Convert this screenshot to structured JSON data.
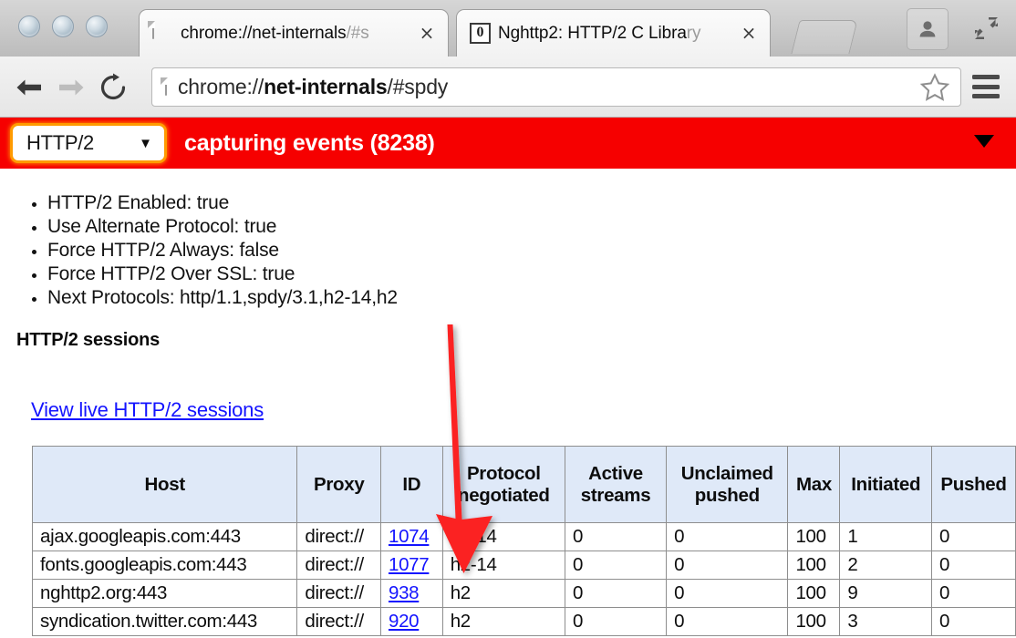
{
  "window": {
    "traffic_lights": [
      "close",
      "minimize",
      "zoom"
    ]
  },
  "tabs": [
    {
      "favicon": "page-icon",
      "title_main": "chrome://net-internals",
      "title_sub": "/#s",
      "close_label": "×",
      "active": true
    },
    {
      "favicon": "nghttp2-icon",
      "favicon_text": "0",
      "title_main": "Nghttp2: HTTP/2 C Libra",
      "title_sub": "ry",
      "close_label": "×",
      "active": false
    }
  ],
  "tabstrip": {
    "new_tab_label": "New Tab",
    "profile_label": "Profile",
    "fullscreen_label": "Enter Full Screen"
  },
  "toolbar": {
    "back_label": "←",
    "forward_label": "→",
    "reload_label": "⟳",
    "url_scheme": "chrome://",
    "url_host": "net-internals",
    "url_path": "/#spdy",
    "bookmark_label": "Bookmark this page",
    "menu_label": "Customize and control Google Chrome"
  },
  "status_bar": {
    "protocol_selected": "HTTP/2",
    "protocol_caret": "▼",
    "capture_text": "capturing events (8238)",
    "capture_count": 8238,
    "expand_caret": "▼",
    "bg_color": "#f60000",
    "focus_ring_color": "#ff9b00"
  },
  "page": {
    "properties": [
      "HTTP/2 Enabled: true",
      "Use Alternate Protocol: true",
      "Force HTTP/2 Always: false",
      "Force HTTP/2 Over SSL: true",
      "Next Protocols: http/1.1,spdy/3.1,h2-14,h2"
    ],
    "section_title": "HTTP/2 sessions",
    "live_link": "View live HTTP/2 sessions",
    "table": {
      "headers": [
        "Host",
        "Proxy",
        "ID",
        "Protocol negotiated",
        "Active streams",
        "Unclaimed pushed",
        "Max",
        "Initiated",
        "Pushed"
      ],
      "rows": [
        {
          "host": "ajax.googleapis.com:443",
          "proxy": "direct://",
          "id": "1074",
          "protocol": "h2-14",
          "active": "0",
          "unclaimed": "0",
          "max": "100",
          "initiated": "1",
          "pushed": "0"
        },
        {
          "host": "fonts.googleapis.com:443",
          "proxy": "direct://",
          "id": "1077",
          "protocol": "h2-14",
          "active": "0",
          "unclaimed": "0",
          "max": "100",
          "initiated": "2",
          "pushed": "0"
        },
        {
          "host": "nghttp2.org:443",
          "proxy": "direct://",
          "id": "938",
          "protocol": "h2",
          "active": "0",
          "unclaimed": "0",
          "max": "100",
          "initiated": "9",
          "pushed": "0"
        },
        {
          "host": "syndication.twitter.com:443",
          "proxy": "direct://",
          "id": "920",
          "protocol": "h2",
          "active": "0",
          "unclaimed": "0",
          "max": "100",
          "initiated": "3",
          "pushed": "0"
        }
      ]
    }
  },
  "annotation": {
    "arrow_color": "#fb2020",
    "points_at": "Protocol negotiated column"
  }
}
